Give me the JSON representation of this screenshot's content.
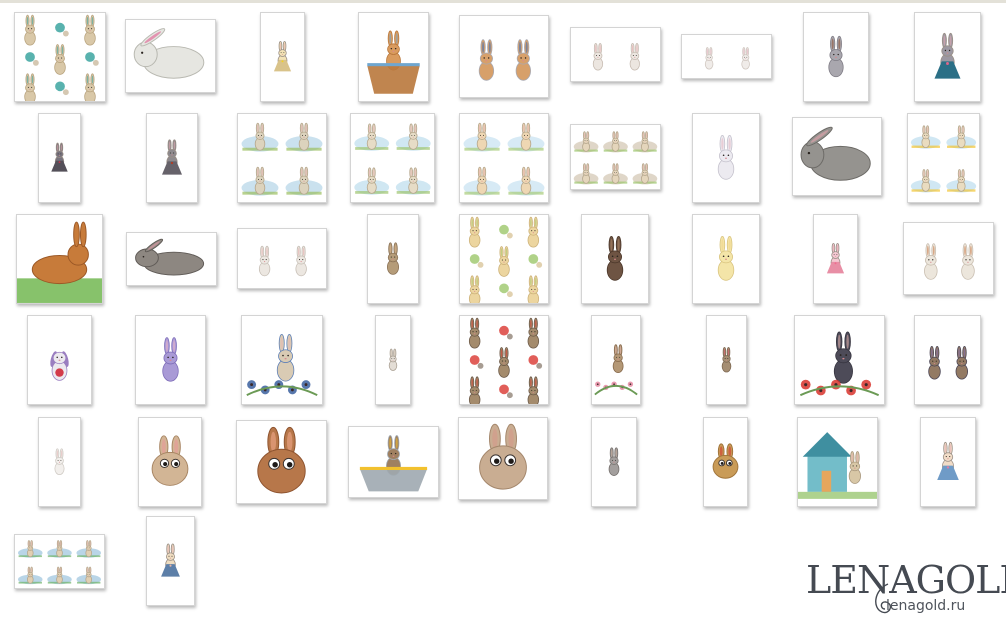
{
  "gallery": {
    "items": [
      {
        "name": "watercolor-bunny-seamless-pattern",
        "bg": "#ffffff",
        "body": "#d9c8a8",
        "shade": "#b9a47f",
        "accent": "#2f9f9a",
        "motif": "pattern"
      },
      {
        "name": "white-bunny-with-flower",
        "bg": "#ffffff",
        "body": "#e6e6e1",
        "shade": "#b8b8b0",
        "accent": "#e05b8f",
        "motif": "lying"
      },
      {
        "name": "bunny-girl-yellow-dress",
        "bg": "#ffffff",
        "body": "#f3e3b6",
        "shade": "#d9c38a",
        "accent": "#f2d21e",
        "motif": "dress"
      },
      {
        "name": "bunny-in-bathtub",
        "bg": "#ffffff",
        "body": "#d99b5e",
        "shade": "#b9783c",
        "accent": "#6fa6cf",
        "motif": "tub"
      },
      {
        "name": "bunnies-reading-book",
        "bg": "#ffffff",
        "body": "#d7a06a",
        "shade": "#a9a9b1",
        "accent": "#2f6cc3",
        "motif": "pair"
      },
      {
        "name": "two-white-bunnies-sitting",
        "bg": "#ffffff",
        "body": "#ece6e0",
        "shade": "#c7bcb2",
        "accent": "#e7a0a8",
        "motif": "pair"
      },
      {
        "name": "two-white-bunnies-lying",
        "bg": "#ffffff",
        "body": "#f0ece9",
        "shade": "#cfc6bf",
        "accent": "#e4a2b4",
        "motif": "pair"
      },
      {
        "name": "grey-bunny-with-leaves",
        "bg": "#ffffff",
        "body": "#a9a7ae",
        "shade": "#7e7b84",
        "accent": "#8a4a2c",
        "motif": "standing"
      },
      {
        "name": "bunny-in-blue-overalls",
        "bg": "#ffffff",
        "body": "#9c98a2",
        "shade": "#2b6f86",
        "accent": "#e0658a",
        "motif": "dress"
      },
      {
        "name": "grey-bunny-glasses-red-pants",
        "bg": "#ffffff",
        "body": "#77737d",
        "shade": "#545059",
        "accent": "#c9334b",
        "motif": "dress"
      },
      {
        "name": "grey-floppy-bunny-glasses",
        "bg": "#ffffff",
        "body": "#8e8a8e",
        "shade": "#66626a",
        "accent": "#b03b24",
        "motif": "dress"
      },
      {
        "name": "bunnies-meadow-scenes",
        "bg": "#ffffff",
        "body": "#dcd3bd",
        "shade": "#9fc9e0",
        "accent": "#9bbf61",
        "motif": "scenes"
      },
      {
        "name": "meadow-clouds-bunnies",
        "bg": "#ffffff",
        "body": "#e6dcc6",
        "shade": "#a9d3e8",
        "accent": "#9ec46f",
        "motif": "scenes"
      },
      {
        "name": "bunnies-bears-clouds",
        "bg": "#ffffff",
        "body": "#eed7b3",
        "shade": "#b7d8ec",
        "accent": "#a8cc7a",
        "motif": "scenes"
      },
      {
        "name": "bunnies-cupcakes-set",
        "bg": "#ffffff",
        "body": "#e4d5bb",
        "shade": "#c5b59b",
        "accent": "#9cc66d",
        "motif": "scenes"
      },
      {
        "name": "fluffy-white-bunny",
        "bg": "#ffffff",
        "body": "#eceaf0",
        "shade": "#c4c1cc",
        "accent": "#e8b5c0",
        "motif": "sitting"
      },
      {
        "name": "grey-leaping-bunny",
        "bg": "#ffffff",
        "body": "#95938f",
        "shade": "#6c6a66",
        "accent": "#e5a3ae",
        "motif": "lying"
      },
      {
        "name": "bunnies-balloons-garden",
        "bg": "#ffffff",
        "body": "#e9dcc0",
        "shade": "#a9d4ea",
        "accent": "#f2c433",
        "motif": "scenes"
      },
      {
        "name": "brown-bunny-on-grass",
        "bg": "#ffffff",
        "body": "#c77b3a",
        "shade": "#9b5826",
        "accent": "#5fae3a",
        "motif": "grass"
      },
      {
        "name": "grey-running-bunny",
        "bg": "#ffffff",
        "body": "#8d8781",
        "shade": "#5f5a56",
        "accent": "#e39aa6",
        "motif": "lying"
      },
      {
        "name": "two-white-bunnies-standing",
        "bg": "#ffffff",
        "body": "#ece7e1",
        "shade": "#c7bfb6",
        "accent": "#e6a9a9",
        "motif": "pair"
      },
      {
        "name": "brown-bunny-sitting-upright",
        "bg": "#ffffff",
        "body": "#b59c79",
        "shade": "#8a7257",
        "accent": "#d8b089",
        "motif": "standing"
      },
      {
        "name": "bunny-seamless-pattern",
        "bg": "#ffffff",
        "body": "#ecd59f",
        "shade": "#cdb27a",
        "accent": "#9cc76a",
        "motif": "pattern"
      },
      {
        "name": "dark-brown-hare",
        "bg": "#ffffff",
        "body": "#6e5443",
        "shade": "#4a3629",
        "accent": "#b58b6a",
        "motif": "sitting"
      },
      {
        "name": "cream-bunny",
        "bg": "#ffffff",
        "body": "#f4e5a8",
        "shade": "#d9c47f",
        "accent": "#f0d487",
        "motif": "sitting"
      },
      {
        "name": "pink-bunny-ballerina",
        "bg": "#ffffff",
        "body": "#f5c8d2",
        "shade": "#e88ea5",
        "accent": "#f06b8e",
        "motif": "dress"
      },
      {
        "name": "bunnies-with-cake",
        "bg": "#ffffff",
        "body": "#ece6dc",
        "shade": "#c8bdaf",
        "accent": "#c7733f",
        "motif": "pair"
      },
      {
        "name": "purple-eared-bunny-strawberry",
        "bg": "#ffffff",
        "body": "#ece9ef",
        "shade": "#9a7ec0",
        "accent": "#d33a4a",
        "motif": "sitting"
      },
      {
        "name": "lilac-bunny",
        "bg": "#ffffff",
        "body": "#a99ad6",
        "shade": "#7d6cb8",
        "accent": "#f1b8c6",
        "motif": "standing"
      },
      {
        "name": "bunny-with-berries-basket",
        "bg": "#ffffff",
        "body": "#d9cbb4",
        "shade": "#5d7fb6",
        "accent": "#3a5f9e",
        "motif": "bouquet"
      },
      {
        "name": "white-hare-standing",
        "bg": "#ffffff",
        "body": "#e3ddd5",
        "shade": "#a99f92",
        "accent": "#c9b7a3",
        "motif": "standing"
      },
      {
        "name": "hares-with-poppies-pattern",
        "bg": "#ffffff",
        "body": "#a48b6c",
        "shade": "#6c5a49",
        "accent": "#d9362f",
        "motif": "pattern"
      },
      {
        "name": "hare-with-flowers",
        "bg": "#ffffff",
        "body": "#b49876",
        "shade": "#86694c",
        "accent": "#e58aa1",
        "motif": "bouquet"
      },
      {
        "name": "hare-holding-flowers",
        "bg": "#ffffff",
        "body": "#a58e73",
        "shade": "#7d6852",
        "accent": "#e0526b",
        "motif": "standing"
      },
      {
        "name": "dark-bunny-with-poppies",
        "bg": "#ffffff",
        "body": "#4d4b58",
        "shade": "#35333e",
        "accent": "#d8322c",
        "motif": "bouquet"
      },
      {
        "name": "two-hares-lavender",
        "bg": "#ffffff",
        "body": "#937a63",
        "shade": "#4b4656",
        "accent": "#7b6ab8",
        "motif": "pair"
      },
      {
        "name": "white-bunny-sketch",
        "bg": "#ffffff",
        "body": "#f2efec",
        "shade": "#cfcac4",
        "accent": "#e0b0b0",
        "motif": "standing"
      },
      {
        "name": "chubby-bunny-big-eyes",
        "bg": "#ffffff",
        "body": "#d2b595",
        "shade": "#a88664",
        "accent": "#e89a9a",
        "motif": "googly"
      },
      {
        "name": "brown-bunny-lying-big-eyes",
        "bg": "#ffffff",
        "body": "#b7774a",
        "shade": "#8e5430",
        "accent": "#f0a98a",
        "motif": "googly"
      },
      {
        "name": "bunny-in-flower-pot",
        "bg": "#ffffff",
        "body": "#a08060",
        "shade": "#9fa8b0",
        "accent": "#f2c12e",
        "motif": "tub"
      },
      {
        "name": "floppy-eared-bunny-big-eyes",
        "bg": "#ffffff",
        "body": "#c9ad92",
        "shade": "#a4876c",
        "accent": "#d69a8a",
        "motif": "googly"
      },
      {
        "name": "grey-hare-standing",
        "bg": "#ffffff",
        "body": "#a39f9d",
        "shade": "#77726f",
        "accent": "#c9a793",
        "motif": "standing"
      },
      {
        "name": "bunny-santa-hat",
        "bg": "#ffffff",
        "body": "#c99b57",
        "shade": "#a0743a",
        "accent": "#d23a31",
        "motif": "googly"
      },
      {
        "name": "bunny-house-garden",
        "bg": "#ffffff",
        "body": "#d8c7a6",
        "shade": "#5ab1bf",
        "accent": "#e6a65c",
        "motif": "house"
      },
      {
        "name": "bunny-girl-blue-dress-flowers",
        "bg": "#ffffff",
        "body": "#f1dcc7",
        "shade": "#6f9bc7",
        "accent": "#e37aa2",
        "motif": "dress"
      },
      {
        "name": "bunnies-birdhouse-set",
        "bg": "#ffffff",
        "body": "#e1cfb2",
        "shade": "#7fb2d4",
        "accent": "#6fb46a",
        "motif": "scenes"
      },
      {
        "name": "bunny-boy-blue-overalls",
        "bg": "#ffffff",
        "body": "#eedcc0",
        "shade": "#5d7fa8",
        "accent": "#e8b3a3",
        "motif": "dress"
      }
    ]
  },
  "watermark": {
    "brand": "LENAGOLD",
    "site": "lenagold.ru"
  },
  "colors": {
    "frame_border": "#d4d4d4",
    "top_rule": "#e3e1d8",
    "logo_text": "#454a52"
  }
}
